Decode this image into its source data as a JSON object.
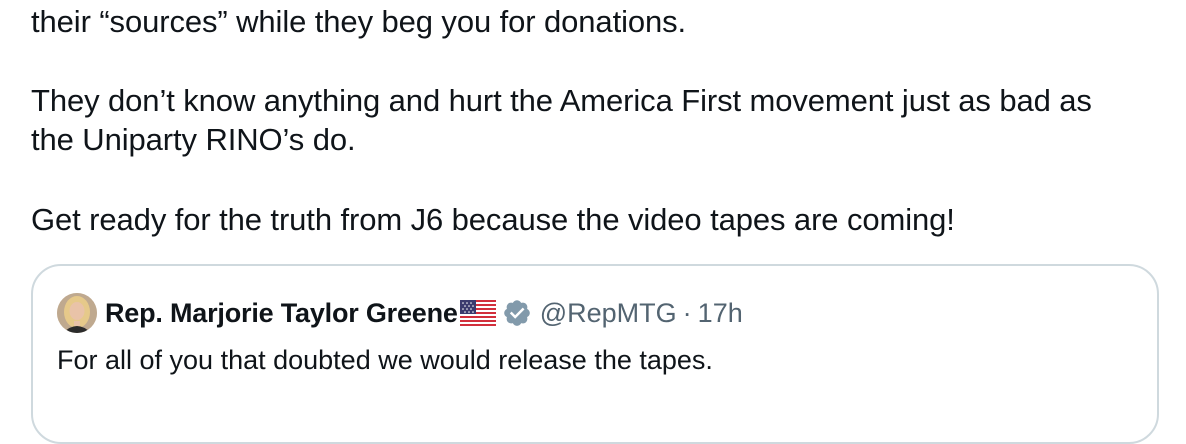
{
  "tweet": {
    "line_1": "their “sources” while they beg you for donations.",
    "paragraph_2": "They don’t know anything and hurt the America First movement just as bad as the Uniparty RINO’s do.",
    "paragraph_3": "Get ready for the truth from J6 because the video tapes are coming!"
  },
  "quoted_tweet": {
    "author_name": "Rep. Marjorie Taylor Greene",
    "flag_icon": "us-flag-icon",
    "verified_icon": "verified-badge-icon",
    "handle": "@RepMTG",
    "separator": "·",
    "time": "17h",
    "text": "For all of you that doubted we would release the tapes."
  },
  "colors": {
    "text_primary": "#0f1419",
    "text_secondary": "#536471",
    "border": "#cfd9de",
    "verified_badge": "#829aab"
  }
}
